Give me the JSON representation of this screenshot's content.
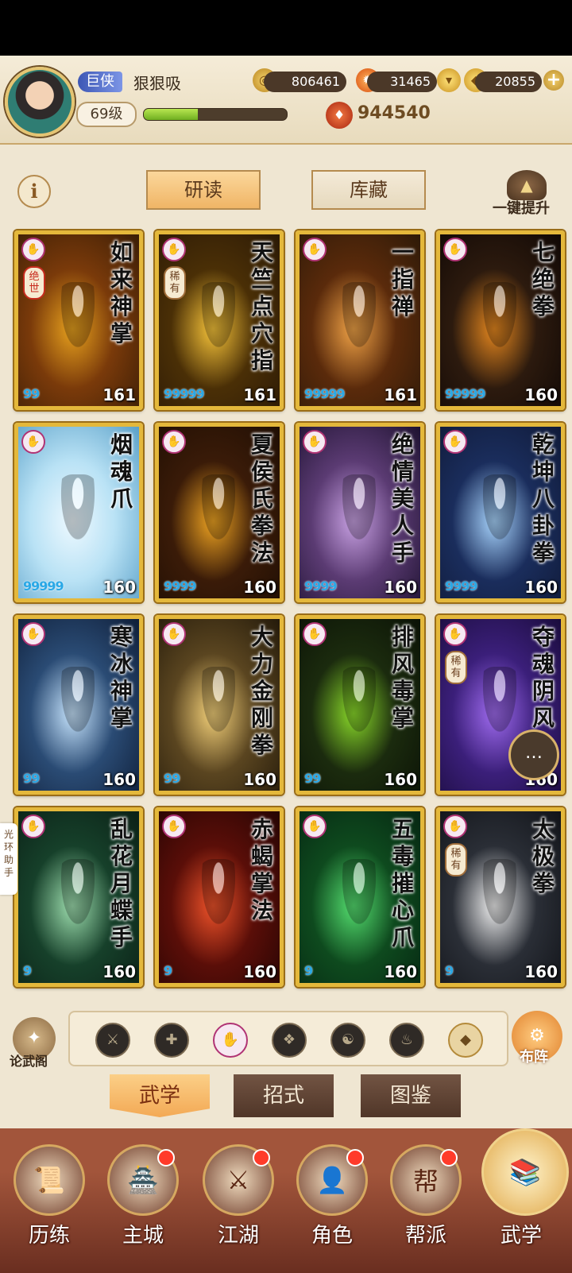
{
  "player": {
    "rank": "巨侠",
    "name": "狠狠吸",
    "level": "69级",
    "exp_fraction": 0.38,
    "avatar": "hero-portrait"
  },
  "resources": {
    "coins": "806461",
    "gems": "31465",
    "ingots": "20855",
    "power": "944540"
  },
  "tabs": {
    "read_label": "研读",
    "collection_label": "库藏",
    "upgrade_label": "一键提升"
  },
  "cards": [
    {
      "title": "如来神掌",
      "tag": "绝世",
      "tag_style": "red",
      "stars": "99",
      "level": "161",
      "colors": [
        "#7a3a0a",
        "#e8a21e",
        "#3a1d06"
      ]
    },
    {
      "title": "天竺点穴指",
      "tag": "稀有",
      "tag_style": "normal",
      "stars": "99999",
      "level": "161",
      "colors": [
        "#4a2f06",
        "#f8c53a",
        "#2b1905"
      ]
    },
    {
      "title": "一指禅",
      "tag": "",
      "tag_style": "",
      "stars": "99999",
      "level": "161",
      "colors": [
        "#5a2a0b",
        "#f2a447",
        "#2e1a08"
      ]
    },
    {
      "title": "七绝拳",
      "tag": "",
      "tag_style": "",
      "stars": "99999",
      "level": "160",
      "colors": [
        "#2c1a0e",
        "#e8891f",
        "#100805"
      ]
    },
    {
      "title": "烟魂爪",
      "tag": "",
      "tag_style": "",
      "stars": "99999",
      "level": "160",
      "colors": [
        "#b9e2f5",
        "#eef9ff",
        "#5aa0c8"
      ]
    },
    {
      "title": "夏侯氏拳法",
      "tag": "",
      "tag_style": "",
      "stars": "9999",
      "level": "160",
      "colors": [
        "#3a1b08",
        "#f0a522",
        "#1f0e04"
      ]
    },
    {
      "title": "绝情美人手",
      "tag": "",
      "tag_style": "",
      "stars": "9999",
      "level": "160",
      "colors": [
        "#5b3b73",
        "#c9a2e4",
        "#1e1230"
      ]
    },
    {
      "title": "乾坤八卦拳",
      "tag": "",
      "tag_style": "",
      "stars": "9999",
      "level": "160",
      "colors": [
        "#1a2d5c",
        "#a9d6ff",
        "#101a38"
      ]
    },
    {
      "title": "寒冰神掌",
      "tag": "",
      "tag_style": "",
      "stars": "99",
      "level": "160",
      "colors": [
        "#2a4b74",
        "#c8e6ff",
        "#0f1e38"
      ]
    },
    {
      "title": "大力金刚拳",
      "tag": "",
      "tag_style": "",
      "stars": "99",
      "level": "160",
      "colors": [
        "#5a4520",
        "#f5d27a",
        "#241a0a"
      ]
    },
    {
      "title": "排风毒掌",
      "tag": "",
      "tag_style": "",
      "stars": "99",
      "level": "160",
      "colors": [
        "#1b2b0e",
        "#8bdc2a",
        "#0b1206"
      ]
    },
    {
      "title": "夺魂阴风",
      "tag": "稀有",
      "tag_style": "normal",
      "stars": "",
      "level": "160",
      "colors": [
        "#3b1f7a",
        "#a06cf0",
        "#1a0c3c"
      ]
    },
    {
      "title": "乱花月蝶手",
      "tag": "",
      "tag_style": "",
      "stars": "9",
      "level": "160",
      "colors": [
        "#16402a",
        "#9fe0b0",
        "#0b2016"
      ]
    },
    {
      "title": "赤蝎掌法",
      "tag": "",
      "tag_style": "",
      "stars": "9",
      "level": "160",
      "colors": [
        "#5a0e08",
        "#f0532a",
        "#250504"
      ]
    },
    {
      "title": "五毒摧心爪",
      "tag": "",
      "tag_style": "",
      "stars": "9",
      "level": "160",
      "colors": [
        "#0e4a1e",
        "#55e070",
        "#062612"
      ]
    },
    {
      "title": "太极拳",
      "tag": "稀有",
      "tag_style": "normal",
      "stars": "9",
      "level": "160",
      "colors": [
        "#2a2e36",
        "#f2f2f2",
        "#111318"
      ]
    }
  ],
  "side_tab": "光环助手",
  "filters": {
    "left_label": "论武阁",
    "right_label": "布阵",
    "dots": [
      "sword-icon",
      "spear-icon",
      "palm-icon",
      "crane-icon",
      "taiji-icon",
      "dragon-icon",
      "collapse-icon"
    ]
  },
  "sub_tabs": [
    "武学",
    "招式",
    "图鉴"
  ],
  "nav": [
    {
      "label": "历练",
      "badge": false
    },
    {
      "label": "主城",
      "badge": true
    },
    {
      "label": "江湖",
      "badge": true
    },
    {
      "label": "角色",
      "badge": true
    },
    {
      "label": "帮派",
      "badge": true
    },
    {
      "label": "武学",
      "badge": false,
      "selected": true
    }
  ]
}
